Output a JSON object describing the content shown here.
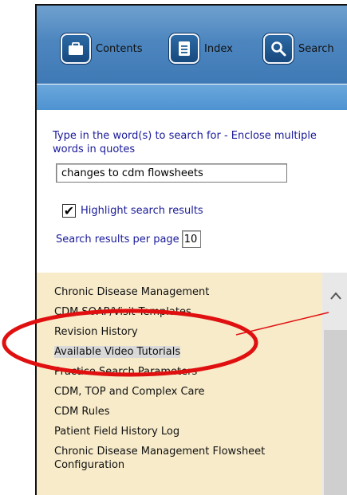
{
  "toolbar": {
    "contents_label": "Contents",
    "index_label": "Index",
    "search_label": "Search"
  },
  "search": {
    "instructions": "Type in the word(s) to search for - Enclose multiple words in quotes",
    "query": "changes to cdm flowsheets",
    "highlight_label": "Highlight search results",
    "highlight_checked": true,
    "results_per_page_label": "Search results per page",
    "results_per_page": "10"
  },
  "results": {
    "items": [
      "Chronic Disease Management",
      "CDM SOAP/Visit Templates",
      "Revision History",
      "Available Video Tutorials",
      "Practice Search Parameters",
      "CDM, TOP and Complex Care",
      "CDM Rules",
      "Patient Field History Log",
      "Chronic Disease Management Flowsheet Configuration"
    ],
    "selected_index": 3
  },
  "annotation": {
    "color": "#e01010"
  },
  "colors": {
    "toolbar": "#4d86bf",
    "results_bg": "#f7ebca",
    "instruction_text": "#1a1a9a"
  }
}
